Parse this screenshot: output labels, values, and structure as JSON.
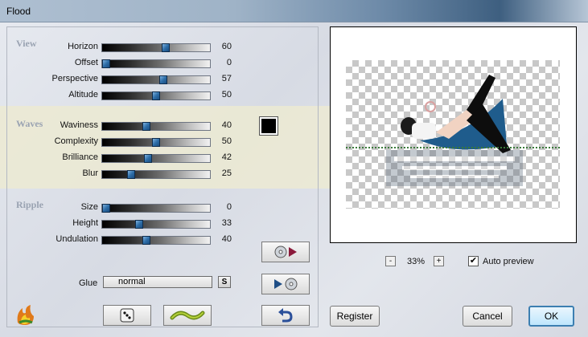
{
  "window": {
    "title": "Flood"
  },
  "groups": {
    "view": {
      "title": "View",
      "sliders": [
        {
          "label": "Horizon",
          "value": "60",
          "fraction": 0.6
        },
        {
          "label": "Offset",
          "value": "0",
          "fraction": 0.0
        },
        {
          "label": "Perspective",
          "value": "57",
          "fraction": 0.57
        },
        {
          "label": "Altitude",
          "value": "50",
          "fraction": 0.5
        }
      ]
    },
    "waves": {
      "title": "Waves",
      "sliders": [
        {
          "label": "Waviness",
          "value": "40",
          "fraction": 0.4
        },
        {
          "label": "Complexity",
          "value": "50",
          "fraction": 0.5
        },
        {
          "label": "Brilliance",
          "value": "42",
          "fraction": 0.42
        },
        {
          "label": "Blur",
          "value": "25",
          "fraction": 0.25
        }
      ],
      "color": "#000000"
    },
    "ripple": {
      "title": "Ripple",
      "sliders": [
        {
          "label": "Size",
          "value": "0",
          "fraction": 0.0
        },
        {
          "label": "Height",
          "value": "33",
          "fraction": 0.33
        },
        {
          "label": "Undulation",
          "value": "40",
          "fraction": 0.4
        }
      ]
    }
  },
  "glue": {
    "label": "Glue",
    "value": "normal",
    "s_label": "S"
  },
  "zoom": {
    "minus": "-",
    "value": "33%",
    "plus": "+"
  },
  "auto_preview": {
    "label": "Auto preview",
    "checked": true,
    "mark": "✔"
  },
  "buttons": {
    "register": "Register",
    "cancel": "Cancel",
    "ok": "OK"
  },
  "icons": {
    "app": "flame-logo-icon",
    "random": "dice-icon",
    "wave": "wave-icon",
    "undo": "undo-arrow-icon",
    "save_preset": "disc-to-play-icon",
    "load_preset": "play-to-disc-icon"
  },
  "colors": {
    "accent": "#3c7fb1",
    "band": "#ecead2",
    "thumb": "#2e6ea8"
  }
}
